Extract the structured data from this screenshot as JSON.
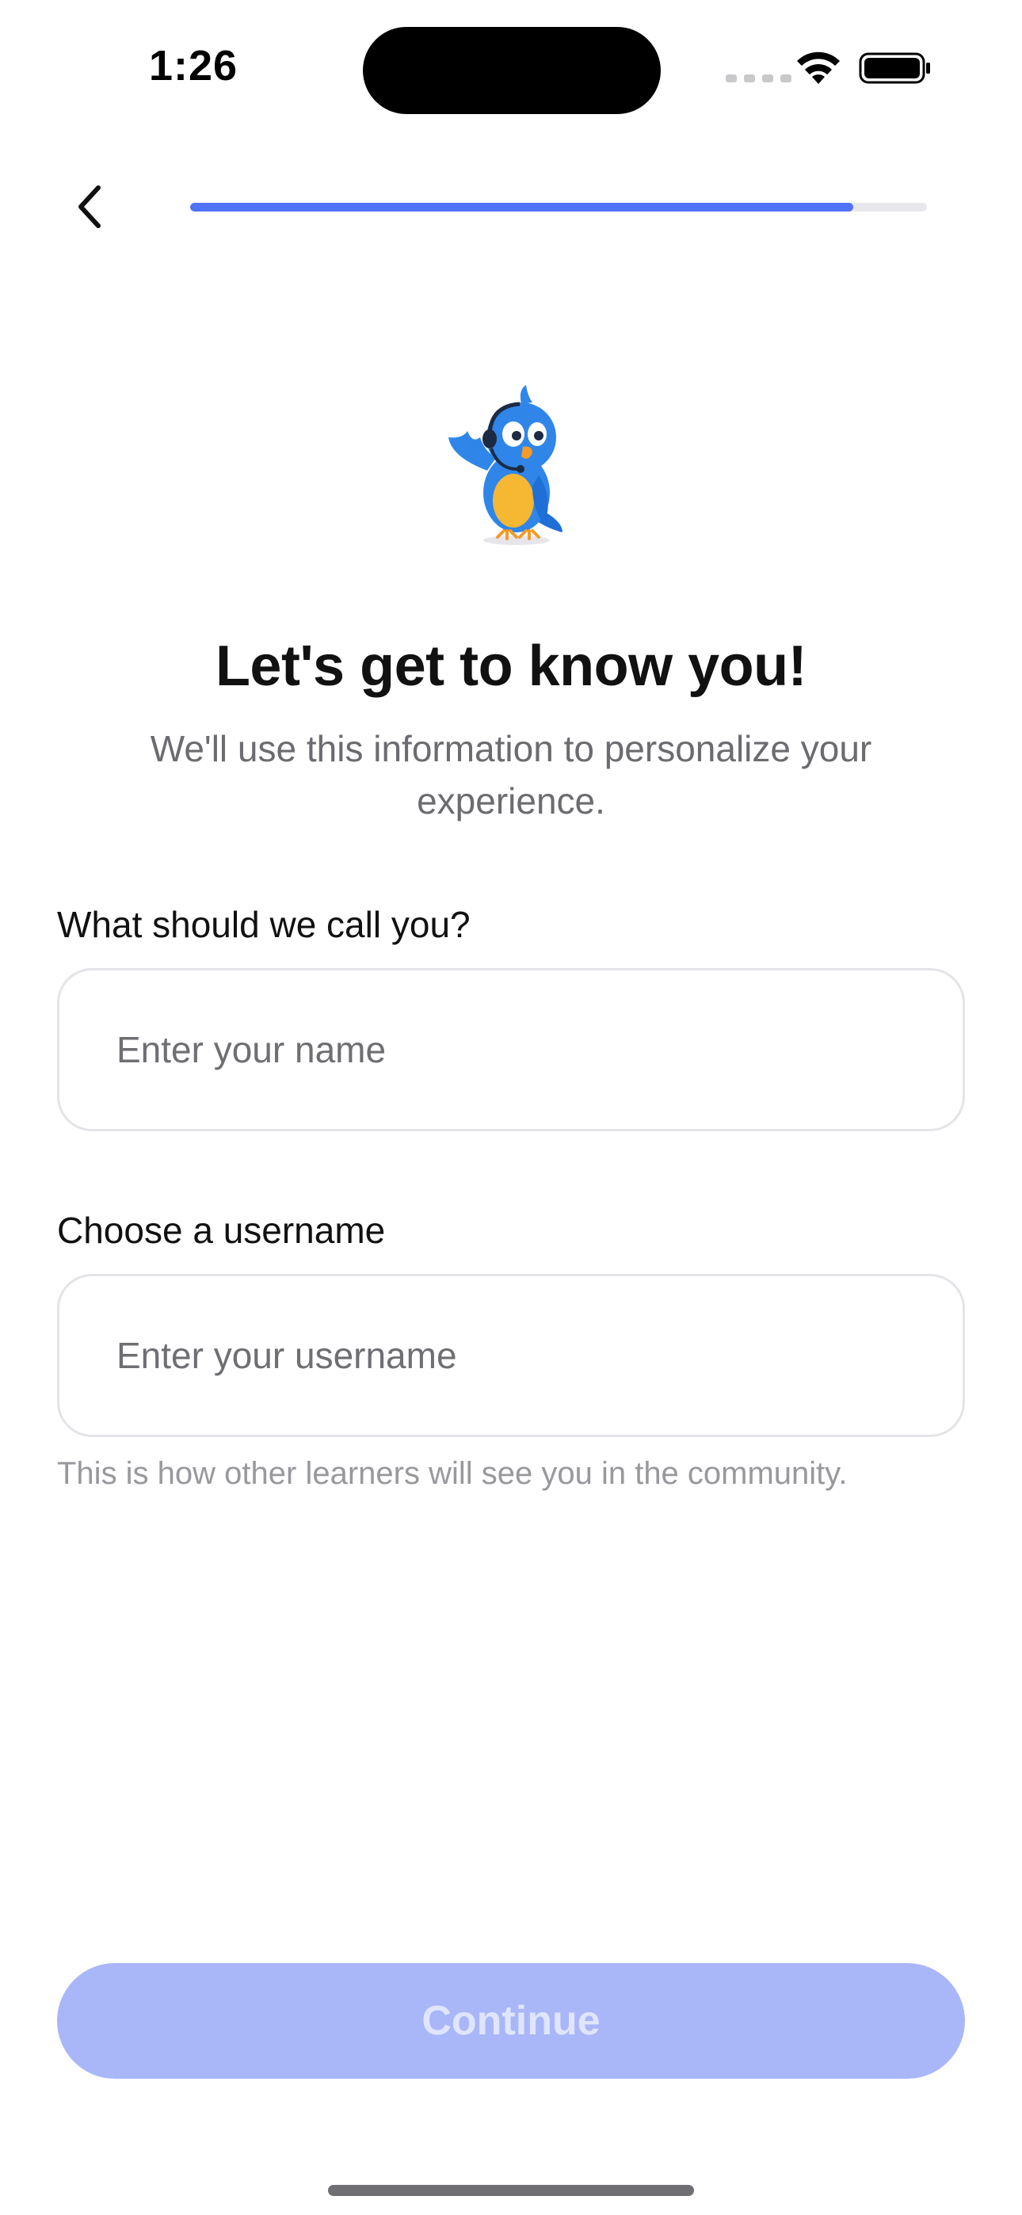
{
  "status_bar": {
    "time": "1:26"
  },
  "header": {
    "back_icon": "chevron-left-icon",
    "progress": 0.9
  },
  "hero": {
    "mascot_icon": "bird-mascot-icon",
    "title": "Let's get to know you!",
    "subtitle": "We'll use this information to personalize your experience."
  },
  "form": {
    "name_label": "What should we call you?",
    "name_placeholder": "Enter your name",
    "name_value": "",
    "username_label": "Choose a username",
    "username_placeholder": "Enter your username",
    "username_value": "",
    "username_helper": "This is how other learners will see you in the community."
  },
  "footer": {
    "continue_label": "Continue"
  },
  "colors": {
    "accent": "#4f73f6",
    "button_disabled": "#a9b7f9",
    "progress_track": "#e7e7ec"
  }
}
